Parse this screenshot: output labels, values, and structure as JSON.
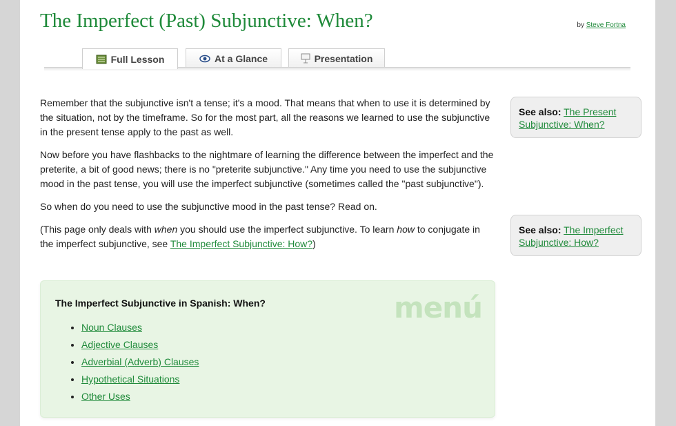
{
  "header": {
    "title": "The Imperfect (Past) Subjunctive: When?",
    "by_prefix": "by",
    "author": "Steve Fortna"
  },
  "tabs": [
    {
      "label": "Full Lesson",
      "icon": "lesson-book-icon",
      "active": true
    },
    {
      "label": "At a Glance",
      "icon": "eye-icon",
      "active": false
    },
    {
      "label": "Presentation",
      "icon": "presentation-icon",
      "active": false
    }
  ],
  "body": {
    "p1": "Remember that the subjunctive isn't a tense; it's a mood. That means that when to use it is determined by the situation, not by the timeframe. So for the most part, all the reasons we learned to use the subjunctive in the present tense apply to the past as well.",
    "p2": "Now before you have flashbacks to the nightmare of learning the difference between the imperfect and the preterite, a bit of good news; there is no \"preterite subjunctive.\" Any time you need to use the subjunctive mood in the past tense, you will use the imperfect subjunctive (sometimes called the \"past subjunctive\").",
    "p3": "So when do you need to use the subjunctive mood in the past tense? Read on.",
    "p4": {
      "a": "(This page only deals with ",
      "b": "when",
      "c": " you should use the imperfect subjunctive. To learn ",
      "d": "how",
      "e": " to conjugate in the imperfect subjunctive, see ",
      "link": "The Imperfect Subjunctive: How?",
      "f": ")"
    }
  },
  "see_also": [
    {
      "label": "See also:",
      "link": "The Present Subjunctive: When?"
    },
    {
      "label": "See also:",
      "link": "The Imperfect Subjunctive: How?"
    }
  ],
  "menu": {
    "title": "The Imperfect Subjunctive in Spanish: When?",
    "watermark": "menú",
    "items": [
      "Noun Clauses",
      "Adjective Clauses",
      "Adverbial (Adverb) Clauses",
      "Hypothetical Situations",
      "Other Uses"
    ]
  },
  "colors": {
    "link_green": "#1f8a3a",
    "menu_bg": "#e8f5e4",
    "aside_bg": "#efefef"
  }
}
